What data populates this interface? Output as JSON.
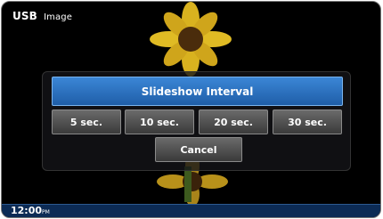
{
  "header": {
    "title": "USB",
    "subtitle": "Image"
  },
  "dialog": {
    "title": "Slideshow Interval",
    "options": [
      "5 sec.",
      "10 sec.",
      "20 sec.",
      "30 sec."
    ],
    "cancel_label": "Cancel"
  },
  "status": {
    "time": "12:00",
    "ampm": "PM"
  },
  "colors": {
    "header_blue": "#2a6fbf",
    "button_gray": "#4d4d4d",
    "status_bar": "#0c2b55"
  },
  "icons": {
    "background": "sunflower-image"
  }
}
